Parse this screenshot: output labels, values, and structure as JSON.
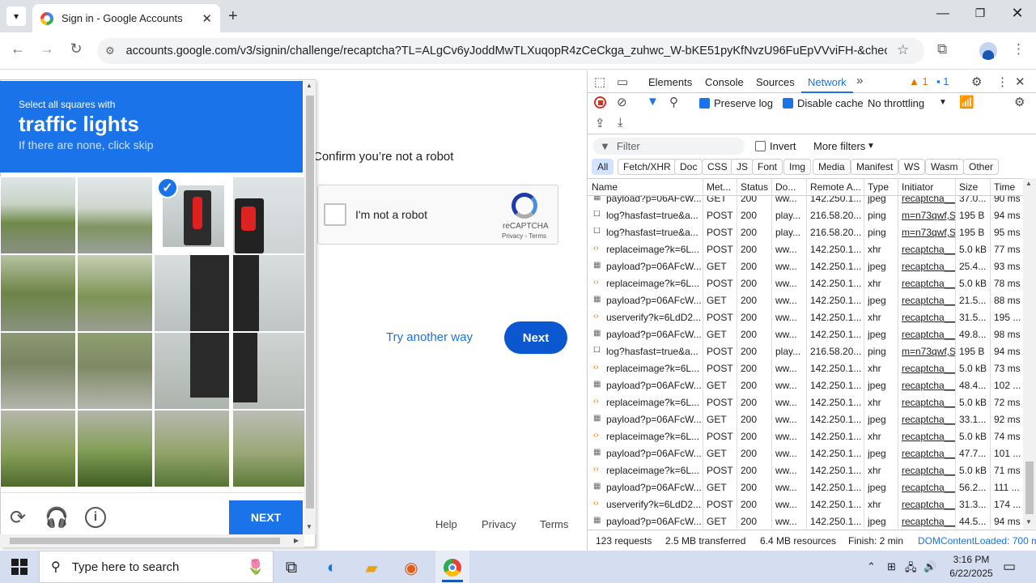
{
  "browser": {
    "tab_title": "Sign in - Google Accounts",
    "url": "accounts.google.com/v3/signin/challenge/recaptcha?TL=ALgCv6yJoddMwTLXuqopR4zCeCkga_zuhwc_W-bKE51pyKfNvzU96FuEpVVviFH-&checkConn..."
  },
  "page": {
    "confirm_text": "Confirm you’re not a robot",
    "recaptcha_label": "I'm not a robot",
    "recaptcha_brand": "reCAPTCHA",
    "recaptcha_privacy": "Privacy",
    "recaptcha_terms": "Terms",
    "recaptcha_sep": " - ",
    "try_another": "Try another way",
    "next": "Next",
    "footer": {
      "help": "Help",
      "privacy": "Privacy",
      "terms": "Terms"
    }
  },
  "captcha": {
    "instruction": "Select all squares with",
    "target": "traffic lights",
    "skip_hint": "If there are none, click skip",
    "next_label": "NEXT",
    "selected_tile": "row 1, column 3",
    "icons": [
      "reload-icon",
      "audio-icon",
      "info-icon"
    ]
  },
  "devtools": {
    "tabs": [
      "Elements",
      "Console",
      "Sources",
      "Network"
    ],
    "active_tab": "Network",
    "warnings": "1",
    "messages": "1",
    "preserve_log": "Preserve log",
    "disable_cache": "Disable cache",
    "throttling": "No throttling",
    "filter_placeholder": "Filter",
    "invert": "Invert",
    "more_filters": "More filters",
    "chips": [
      "All",
      "Fetch/XHR",
      "Doc",
      "CSS",
      "JS",
      "Font",
      "Img",
      "Media",
      "Manifest",
      "WS",
      "Wasm",
      "Other"
    ],
    "columns": [
      "Name",
      "Met...",
      "Status",
      "Do...",
      "Remote A...",
      "Type",
      "Initiator",
      "Size",
      "Time"
    ],
    "rows": [
      {
        "name": "payload?p=06AFcW...",
        "method": "GET",
        "status": "200",
        "domain": "ww...",
        "remote": "142.250.1...",
        "type": "jpeg",
        "initiator": "recaptcha__e",
        "size": "37.0...",
        "time": "90 ms",
        "kind": "img"
      },
      {
        "name": "log?hasfast=true&a...",
        "method": "POST",
        "status": "200",
        "domain": "play...",
        "remote": "216.58.20...",
        "type": "ping",
        "initiator": "m=n73qwf,S",
        "size": "195 B",
        "time": "94 ms",
        "kind": "doc"
      },
      {
        "name": "log?hasfast=true&a...",
        "method": "POST",
        "status": "200",
        "domain": "play...",
        "remote": "216.58.20...",
        "type": "ping",
        "initiator": "m=n73qwf,S",
        "size": "195 B",
        "time": "95 ms",
        "kind": "doc"
      },
      {
        "name": "replaceimage?k=6L...",
        "method": "POST",
        "status": "200",
        "domain": "ww...",
        "remote": "142.250.1...",
        "type": "xhr",
        "initiator": "recaptcha__e",
        "size": "5.0 kB",
        "time": "77 ms",
        "kind": "xhr"
      },
      {
        "name": "payload?p=06AFcW...",
        "method": "GET",
        "status": "200",
        "domain": "ww...",
        "remote": "142.250.1...",
        "type": "jpeg",
        "initiator": "recaptcha__e",
        "size": "25.4...",
        "time": "93 ms",
        "kind": "img"
      },
      {
        "name": "replaceimage?k=6L...",
        "method": "POST",
        "status": "200",
        "domain": "ww...",
        "remote": "142.250.1...",
        "type": "xhr",
        "initiator": "recaptcha__e",
        "size": "5.0 kB",
        "time": "78 ms",
        "kind": "xhr"
      },
      {
        "name": "payload?p=06AFcW...",
        "method": "GET",
        "status": "200",
        "domain": "ww...",
        "remote": "142.250.1...",
        "type": "jpeg",
        "initiator": "recaptcha__e",
        "size": "21.5...",
        "time": "88 ms",
        "kind": "img"
      },
      {
        "name": "userverify?k=6LdD2...",
        "method": "POST",
        "status": "200",
        "domain": "ww...",
        "remote": "142.250.1...",
        "type": "xhr",
        "initiator": "recaptcha__e",
        "size": "31.5...",
        "time": "195 ...",
        "kind": "xhr"
      },
      {
        "name": "payload?p=06AFcW...",
        "method": "GET",
        "status": "200",
        "domain": "ww...",
        "remote": "142.250.1...",
        "type": "jpeg",
        "initiator": "recaptcha__e",
        "size": "49.8...",
        "time": "98 ms",
        "kind": "img"
      },
      {
        "name": "log?hasfast=true&a...",
        "method": "POST",
        "status": "200",
        "domain": "play...",
        "remote": "216.58.20...",
        "type": "ping",
        "initiator": "m=n73qwf,S",
        "size": "195 B",
        "time": "94 ms",
        "kind": "doc"
      },
      {
        "name": "replaceimage?k=6L...",
        "method": "POST",
        "status": "200",
        "domain": "ww...",
        "remote": "142.250.1...",
        "type": "xhr",
        "initiator": "recaptcha__e",
        "size": "5.0 kB",
        "time": "73 ms",
        "kind": "xhr"
      },
      {
        "name": "payload?p=06AFcW...",
        "method": "GET",
        "status": "200",
        "domain": "ww...",
        "remote": "142.250.1...",
        "type": "jpeg",
        "initiator": "recaptcha__e",
        "size": "48.4...",
        "time": "102 ...",
        "kind": "img"
      },
      {
        "name": "replaceimage?k=6L...",
        "method": "POST",
        "status": "200",
        "domain": "ww...",
        "remote": "142.250.1...",
        "type": "xhr",
        "initiator": "recaptcha__e",
        "size": "5.0 kB",
        "time": "72 ms",
        "kind": "xhr"
      },
      {
        "name": "payload?p=06AFcW...",
        "method": "GET",
        "status": "200",
        "domain": "ww...",
        "remote": "142.250.1...",
        "type": "jpeg",
        "initiator": "recaptcha__e",
        "size": "33.1...",
        "time": "92 ms",
        "kind": "img"
      },
      {
        "name": "replaceimage?k=6L...",
        "method": "POST",
        "status": "200",
        "domain": "ww...",
        "remote": "142.250.1...",
        "type": "xhr",
        "initiator": "recaptcha__e",
        "size": "5.0 kB",
        "time": "74 ms",
        "kind": "xhr"
      },
      {
        "name": "payload?p=06AFcW...",
        "method": "GET",
        "status": "200",
        "domain": "ww...",
        "remote": "142.250.1...",
        "type": "jpeg",
        "initiator": "recaptcha__e",
        "size": "47.7...",
        "time": "101 ...",
        "kind": "img"
      },
      {
        "name": "replaceimage?k=6L...",
        "method": "POST",
        "status": "200",
        "domain": "ww...",
        "remote": "142.250.1...",
        "type": "xhr",
        "initiator": "recaptcha__e",
        "size": "5.0 kB",
        "time": "71 ms",
        "kind": "xhr"
      },
      {
        "name": "payload?p=06AFcW...",
        "method": "GET",
        "status": "200",
        "domain": "ww...",
        "remote": "142.250.1...",
        "type": "jpeg",
        "initiator": "recaptcha__e",
        "size": "56.2...",
        "time": "111 ...",
        "kind": "img"
      },
      {
        "name": "userverify?k=6LdD2...",
        "method": "POST",
        "status": "200",
        "domain": "ww...",
        "remote": "142.250.1...",
        "type": "xhr",
        "initiator": "recaptcha__e",
        "size": "31.3...",
        "time": "174 ...",
        "kind": "xhr"
      },
      {
        "name": "payload?p=06AFcW...",
        "method": "GET",
        "status": "200",
        "domain": "ww...",
        "remote": "142.250.1...",
        "type": "jpeg",
        "initiator": "recaptcha__e",
        "size": "44.5...",
        "time": "94 ms",
        "kind": "img"
      }
    ],
    "status": {
      "requests": "123 requests",
      "transferred": "2.5 MB transferred",
      "resources": "6.4 MB resources",
      "finish": "Finish: 2 min",
      "dcl": "DOMContentLoaded: 700 m"
    }
  },
  "taskbar": {
    "search_placeholder": "Type here to search",
    "time": "3:16 PM",
    "date": "6/22/2025"
  },
  "colors": {
    "captcha_blue": "#1a73e8",
    "next_blue": "#0b57d0",
    "devtools_accent": "#1a73e8"
  }
}
